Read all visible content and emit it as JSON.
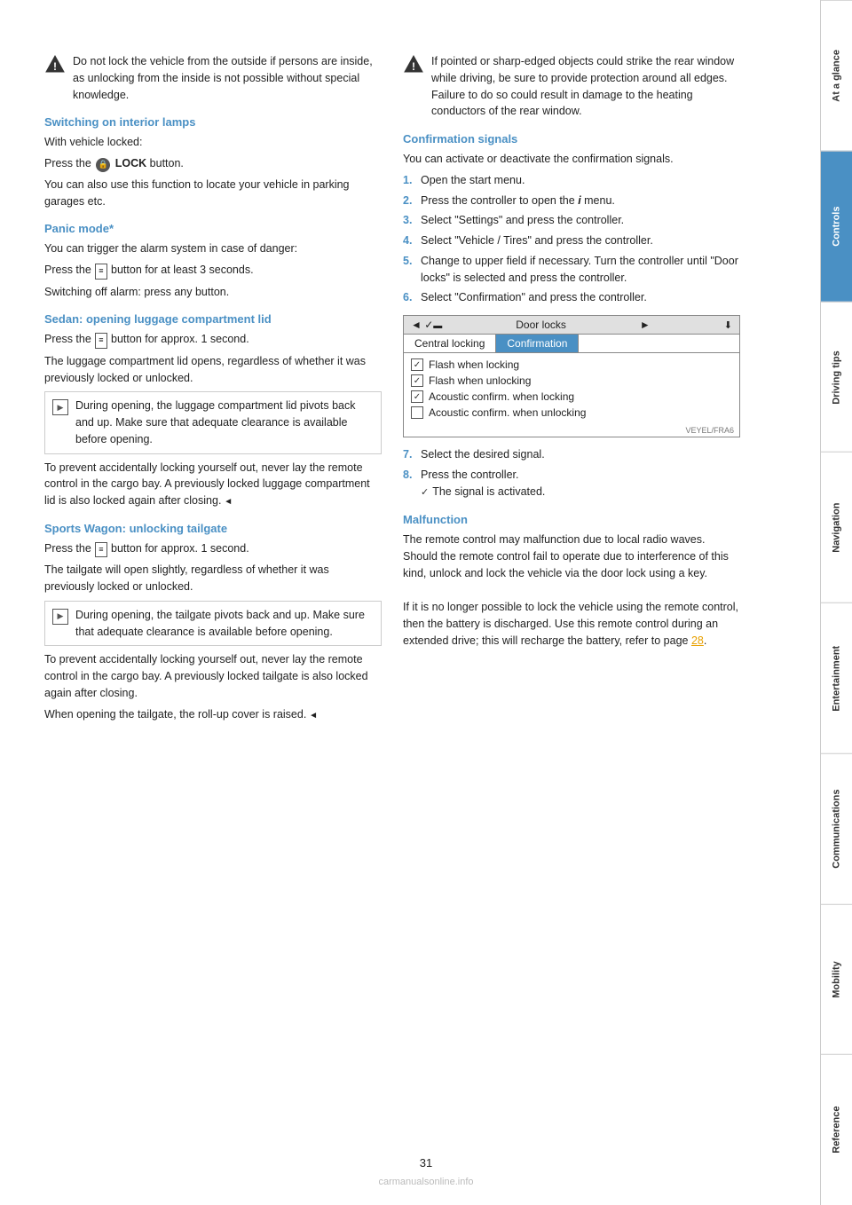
{
  "page": {
    "number": "31",
    "watermark": "carmanualsonline.info"
  },
  "sidebar": {
    "tabs": [
      {
        "label": "At a glance",
        "active": false
      },
      {
        "label": "Controls",
        "active": true
      },
      {
        "label": "Driving tips",
        "active": false
      },
      {
        "label": "Navigation",
        "active": false
      },
      {
        "label": "Entertainment",
        "active": false
      },
      {
        "label": "Communications",
        "active": false
      },
      {
        "label": "Mobility",
        "active": false
      },
      {
        "label": "Reference",
        "active": false
      }
    ]
  },
  "left_col": {
    "warning1": {
      "text": "Do not lock the vehicle from the outside if persons are inside, as unlocking from the inside is not possible without special knowledge."
    },
    "section1": {
      "heading": "Switching on interior lamps",
      "content": [
        "With vehicle locked:",
        "Press the  LOCK button.",
        "You can also use this function to locate your vehicle in parking garages etc."
      ]
    },
    "section2": {
      "heading": "Panic mode*",
      "content": [
        "You can trigger the alarm system in case of danger:",
        "Press the  button for at least 3 seconds.",
        "Switching off alarm: press any button."
      ]
    },
    "section3": {
      "heading": "Sedan: opening luggage compartment lid",
      "content_intro": "Press the  button for approx. 1 second.",
      "content_body": "The luggage compartment lid opens, regardless of whether it was previously locked or unlocked.",
      "note": "During opening, the luggage compartment lid pivots back and up. Make sure that adequate clearance is available before opening.",
      "content_rest": "To prevent accidentally locking yourself out, never lay the remote control in the cargo bay. A previously locked luggage compartment lid is also locked again after closing."
    },
    "section4": {
      "heading": "Sports Wagon: unlocking tailgate",
      "content_intro": "Press the  button for approx. 1 second.",
      "content_body": "The tailgate will open slightly, regardless of whether it was previously locked or unlocked.",
      "note": "During opening, the tailgate pivots back and up. Make sure that adequate clearance is available before opening.",
      "content_rest1": "To prevent accidentally locking yourself out, never lay the remote control in the cargo bay. A previously locked tailgate is also locked again after closing.",
      "content_rest2": "When opening the tailgate, the roll-up cover is raised."
    }
  },
  "right_col": {
    "warning1": {
      "text": "If pointed or sharp-edged objects could strike the rear window while driving, be sure to provide protection around all edges. Failure to do so could result in damage to the heating conductors of the rear window."
    },
    "section1": {
      "heading": "Confirmation signals",
      "intro": "You can activate or deactivate the confirmation signals.",
      "steps": [
        {
          "num": "1.",
          "text": "Open the start menu."
        },
        {
          "num": "2.",
          "text": "Press the controller to open the   menu."
        },
        {
          "num": "3.",
          "text": "Select \"Settings\" and press the controller."
        },
        {
          "num": "4.",
          "text": "Select \"Vehicle / Tires\" and press the controller."
        },
        {
          "num": "5.",
          "text": "Change to upper field if necessary. Turn the controller until \"Door locks\" is selected and press the controller."
        },
        {
          "num": "6.",
          "text": "Select \"Confirmation\" and press the controller."
        }
      ]
    },
    "door_locks_widget": {
      "title": "Door locks",
      "tabs": [
        "Central locking",
        "Confirmation"
      ],
      "active_tab": "Confirmation",
      "items": [
        {
          "checked": true,
          "label": "Flash when locking"
        },
        {
          "checked": true,
          "label": "Flash when unlocking"
        },
        {
          "checked": true,
          "label": "Acoustic confirm. when locking"
        },
        {
          "checked": false,
          "label": "Acoustic confirm. when unlocking"
        }
      ]
    },
    "section2_steps": [
      {
        "num": "7.",
        "text": "Select the desired signal."
      },
      {
        "num": "8.",
        "text": "Press the controller."
      }
    ],
    "activated_text": "The signal is activated.",
    "section3": {
      "heading": "Malfunction",
      "para1": "The remote control may malfunction due to local radio waves. Should the remote control fail to operate due to interference of this kind, unlock and lock the vehicle via the door lock using a key.",
      "para2": "If it is no longer possible to lock the vehicle using the remote control, then the battery is discharged. Use this remote control during an extended drive; this will recharge the battery, refer to page 28."
    }
  }
}
